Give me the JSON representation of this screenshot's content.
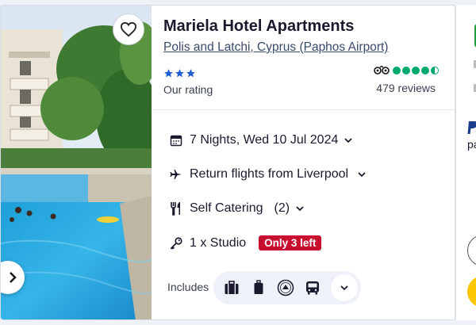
{
  "hotel": {
    "name": "Mariela Hotel Apartments",
    "location": "Polis and Latchi, Cyprus (Paphos Airport)",
    "star_rating": 3,
    "rating_label": "Our rating",
    "tripadvisor_score": 4.5,
    "reviews": "479 reviews"
  },
  "details": {
    "dates": "7 Nights, Wed 10 Jul 2024",
    "flights": "Return flights from Liverpool",
    "board": "Self Catering",
    "board_count": "(2)",
    "room": "1 x Studio",
    "availability_badge": "Only 3 left"
  },
  "includes": {
    "label": "Includes",
    "icons": [
      "suitcase-icon",
      "hand-luggage-icon",
      "atol-protection-icon",
      "transfer-bus-icon"
    ]
  },
  "side_panel": {
    "payment_text": "pa"
  },
  "colors": {
    "brand_blue": "#1f5fd1",
    "tripadvisor_green": "#00aa6c",
    "badge_red": "#c8102e",
    "cta_yellow": "#fcc700"
  }
}
